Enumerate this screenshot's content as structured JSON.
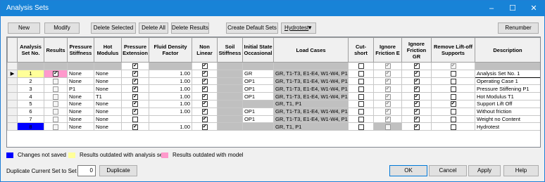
{
  "window": {
    "title": "Analysis Sets",
    "minimize": "–",
    "maximize": "☐",
    "close": "✕"
  },
  "toolbar": {
    "new": "New",
    "modify": "Modify",
    "delete_selected": "Delete Selected",
    "delete_all": "Delete All",
    "delete_results": "Delete Results",
    "create_default_sets": "Create Default Sets",
    "hydrotest": "Hydrotest",
    "renumber": "Renumber"
  },
  "columns": [
    "",
    "Analysis Set No.",
    "Results",
    "Pressure Stiffness",
    "Hot Modulus",
    "Pressure Extension",
    "Fluid Density Factor",
    "Non Linear",
    "Soil Stiffness",
    "Initial State Occasional",
    "Load Cases",
    "Cut-short",
    "Ignore Friction E",
    "Ignore Friction GR",
    "Remove Lift-off Supports",
    "Description"
  ],
  "rows": [
    {
      "set": "1",
      "results": true,
      "ps": "None",
      "hm": "None",
      "pe": true,
      "fdf": "1.00",
      "nl": true,
      "init": "GR",
      "lc": "GR, T1-T3, E1-E4, W1-W4, P1-P",
      "cs": false,
      "ife": true,
      "ifg": true,
      "rlo": false,
      "desc": "Analysis Set No. 1"
    },
    {
      "set": "2",
      "results": false,
      "ps": "None",
      "hm": "None",
      "pe": true,
      "fdf": "1.00",
      "nl": true,
      "init": "OP1",
      "lc": "GR, T1-T3, E1-E4, W1-W4, P1-P",
      "cs": false,
      "ife": true,
      "ifg": true,
      "rlo": false,
      "desc": "Operating Case 1"
    },
    {
      "set": "3",
      "results": false,
      "ps": "P1",
      "hm": "None",
      "pe": true,
      "fdf": "1.00",
      "nl": true,
      "init": "OP1",
      "lc": "GR, T1-T3, E1-E4, W1-W4, P1-P",
      "cs": false,
      "ife": true,
      "ifg": true,
      "rlo": false,
      "desc": "Pressure Stiffening P1"
    },
    {
      "set": "4",
      "results": false,
      "ps": "None",
      "hm": "T1",
      "pe": true,
      "fdf": "1.00",
      "nl": true,
      "init": "OP1",
      "lc": "GR, T1-T3, E1-E4, W1-W4, P1-P",
      "cs": false,
      "ife": true,
      "ifg": true,
      "rlo": false,
      "desc": "Hot Modulus T1"
    },
    {
      "set": "5",
      "results": false,
      "ps": "None",
      "hm": "None",
      "pe": true,
      "fdf": "1.00",
      "nl": true,
      "init": "",
      "lc": "GR, T1, P1",
      "cs": false,
      "ife": true,
      "ifg": true,
      "rlo": true,
      "desc": "Support Lift Off"
    },
    {
      "set": "6",
      "results": false,
      "ps": "None",
      "hm": "None",
      "pe": true,
      "fdf": "1.00",
      "nl": true,
      "init": "OP1",
      "lc": "GR, T1-T3, E1-E4, W1-W4, P1-P",
      "cs": false,
      "ife": true,
      "ifg": true,
      "rlo": false,
      "desc": "Without friction"
    },
    {
      "set": "7",
      "results": false,
      "ps": "None",
      "hm": "None",
      "pe": false,
      "fdf": "",
      "nl": true,
      "init": "OP1",
      "lc": "GR, T1-T3, E1-E4, W1-W4, P1-P",
      "cs": false,
      "ife": true,
      "ifg": true,
      "rlo": false,
      "desc": "Weight no Content"
    },
    {
      "set": "8",
      "results": false,
      "ps": "None",
      "hm": "None",
      "pe": true,
      "fdf": "1.00",
      "nl": true,
      "init": "",
      "lc": "GR, T1, P1",
      "cs": false,
      "ife": false,
      "ifg": true,
      "rlo": false,
      "desc": "Hydrotest"
    }
  ],
  "legend": {
    "not_saved": "Changes not saved",
    "outdated_set": "Results outdated with analysis set",
    "outdated_model": "Results outdated with model",
    "color_blue": "#0000ff",
    "color_yellow": "#ffff99",
    "color_pink": "#ff99cc"
  },
  "bottom": {
    "duplicate_label": "Duplicate Current Set to Set #",
    "duplicate_value": "0",
    "duplicate_button": "Duplicate",
    "ok": "OK",
    "cancel": "Cancel",
    "apply": "Apply",
    "help": "Help"
  }
}
